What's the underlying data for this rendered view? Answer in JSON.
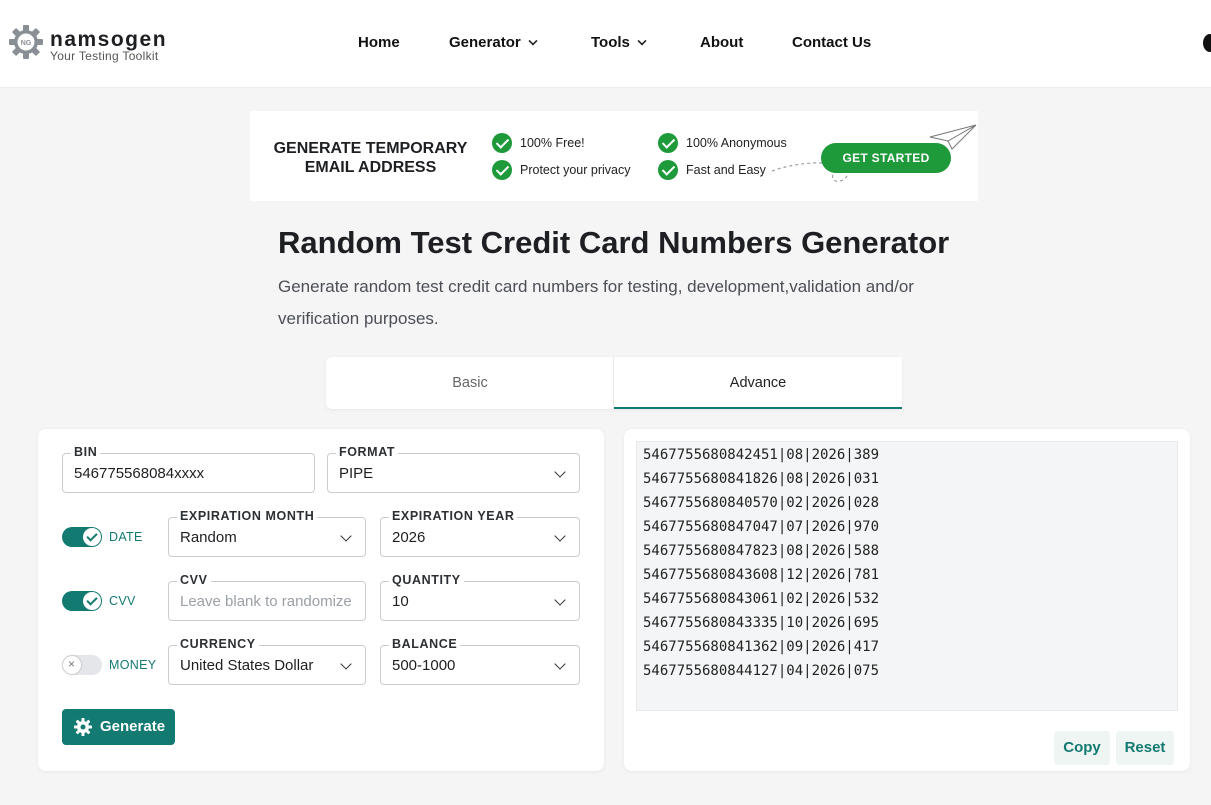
{
  "header": {
    "logo_name": "namsogen",
    "logo_tagline": "Your Testing Toolkit",
    "logo_badge": "NG",
    "nav": [
      {
        "label": "Home",
        "has_dropdown": false
      },
      {
        "label": "Generator",
        "has_dropdown": true
      },
      {
        "label": "Tools",
        "has_dropdown": true
      },
      {
        "label": "About",
        "has_dropdown": false
      },
      {
        "label": "Contact Us",
        "has_dropdown": false
      }
    ],
    "theme_icon": "moon-icon"
  },
  "banner": {
    "title": "GENERATE TEMPORARY EMAIL ADDRESS",
    "features": [
      "100% Free!",
      "Protect your privacy",
      "100% Anonymous",
      "Fast and Easy"
    ],
    "cta_label": "GET STARTED",
    "accent": "#1f9a3a"
  },
  "page": {
    "title": "Random Test Credit Card Numbers Generator",
    "description": "Generate random test credit card numbers for testing, development,validation and/or verification purposes."
  },
  "tabs": [
    {
      "label": "Basic",
      "active": false
    },
    {
      "label": "Advance",
      "active": true
    }
  ],
  "form": {
    "bin": {
      "label": "BIN",
      "value": "546775568084xxxx"
    },
    "format": {
      "label": "FORMAT",
      "value": "PIPE"
    },
    "date_toggle": {
      "label": "DATE",
      "on": true
    },
    "expiration_month": {
      "label": "EXPIRATION MONTH",
      "value": "Random"
    },
    "expiration_year": {
      "label": "EXPIRATION YEAR",
      "value": "2026"
    },
    "cvv_toggle": {
      "label": "CVV",
      "on": true
    },
    "cvv": {
      "label": "CVV",
      "placeholder": "Leave blank to randomize"
    },
    "quantity": {
      "label": "QUANTITY",
      "value": "10"
    },
    "money_toggle": {
      "label": "MONEY",
      "on": false
    },
    "currency": {
      "label": "CURRENCY",
      "value": "United States Dollar"
    },
    "balance": {
      "label": "BALANCE",
      "value": "500-1000"
    },
    "generate_label": "Generate"
  },
  "output": {
    "lines": [
      "5467755680842451|08|2026|389",
      "5467755680841826|08|2026|031",
      "5467755680840570|02|2026|028",
      "5467755680847047|07|2026|970",
      "5467755680847823|08|2026|588",
      "5467755680843608|12|2026|781",
      "5467755680843061|02|2026|532",
      "5467755680843335|10|2026|695",
      "5467755680841362|09|2026|417",
      "5467755680844127|04|2026|075"
    ],
    "copy_label": "Copy",
    "reset_label": "Reset"
  },
  "colors": {
    "primary": "#137a72",
    "banner_green": "#1f9a3a",
    "background": "#f5f5f6"
  }
}
